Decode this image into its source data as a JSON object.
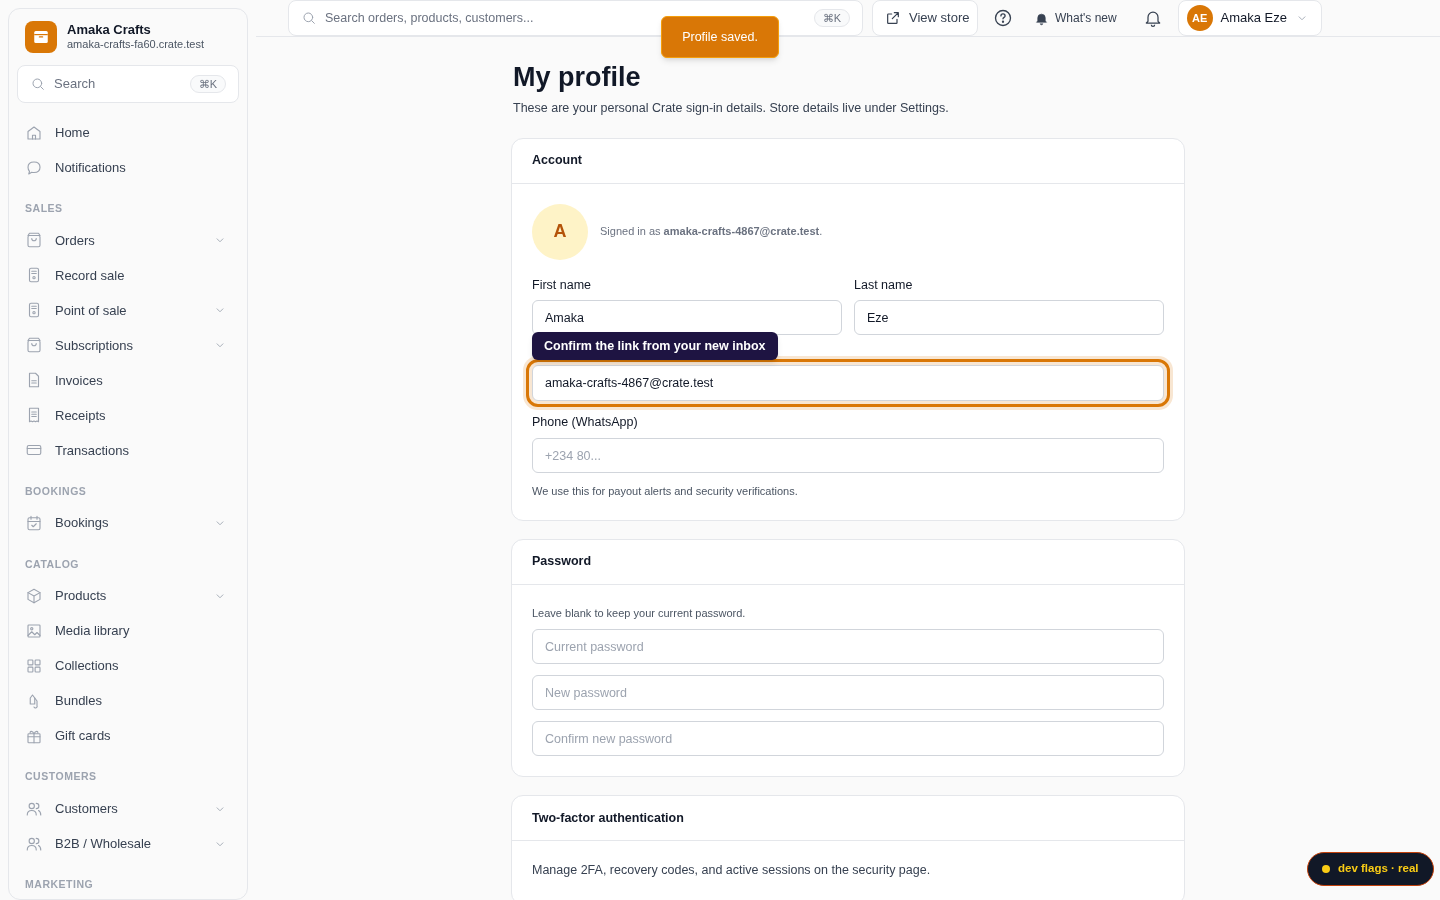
{
  "store": {
    "name": "Amaka Crafts",
    "domain": "amaka-crafts-fa60.crate.test"
  },
  "sidebar": {
    "search": {
      "placeholder": "Search",
      "shortcut": "⌘K"
    },
    "sections": [
      {
        "items": [
          {
            "label": "Home",
            "collapsible": false
          },
          {
            "label": "Notifications",
            "collapsible": false
          }
        ]
      },
      {
        "heading": "SALES",
        "items": [
          {
            "label": "Orders",
            "collapsible": true
          },
          {
            "label": "Record sale",
            "collapsible": false
          },
          {
            "label": "Point of sale",
            "collapsible": true
          },
          {
            "label": "Subscriptions",
            "collapsible": true
          },
          {
            "label": "Invoices",
            "collapsible": false
          },
          {
            "label": "Receipts",
            "collapsible": false
          },
          {
            "label": "Transactions",
            "collapsible": false
          }
        ]
      },
      {
        "heading": "BOOKINGS",
        "items": [
          {
            "label": "Bookings",
            "collapsible": true
          }
        ]
      },
      {
        "heading": "CATALOG",
        "items": [
          {
            "label": "Products",
            "collapsible": true
          },
          {
            "label": "Media library",
            "collapsible": false
          },
          {
            "label": "Collections",
            "collapsible": false
          },
          {
            "label": "Bundles",
            "collapsible": false
          },
          {
            "label": "Gift cards",
            "collapsible": false
          }
        ]
      },
      {
        "heading": "CUSTOMERS",
        "items": [
          {
            "label": "Customers",
            "collapsible": true
          },
          {
            "label": "B2B / Wholesale",
            "collapsible": true
          }
        ]
      },
      {
        "heading": "MARKETING"
      }
    ]
  },
  "topbar": {
    "search": {
      "placeholder": "Search orders, products, customers...",
      "shortcut": "⌘K"
    },
    "view_store": "View store",
    "whats_new": "What's new",
    "user": {
      "initials": "AE",
      "name": "Amaka Eze"
    }
  },
  "toast": "Profile saved.",
  "page": {
    "title": "My profile",
    "subtitle": "These are your personal Crate sign-in details. Store details live under Settings."
  },
  "account": {
    "title": "Account",
    "avatar": "A",
    "signed_in": "Signed in as **amaka-crafts-4867@crate.test**.",
    "first_name": {
      "label": "First name",
      "value": "Amaka"
    },
    "last_name": {
      "label": "Last name",
      "value": "Eze"
    },
    "email": {
      "value": "amaka-crafts-4867@crate.test",
      "focused": true,
      "tooltip": "Confirm the link from your new inbox"
    },
    "phone": {
      "label": "Phone (WhatsApp)",
      "placeholder": "+234 80...",
      "help": "We use this for payout alerts and security verifications."
    }
  },
  "password": {
    "title": "Password",
    "hint": "Leave blank to keep your current password.",
    "fields": [
      {
        "placeholder": "Current password"
      },
      {
        "placeholder": "New password"
      },
      {
        "placeholder": "Confirm new password"
      }
    ]
  },
  "two_factor": {
    "title": "Two-factor authentication",
    "text": "Manage 2FA, recovery codes, and active sessions on the security page."
  },
  "dev_badge": "dev flags · real"
}
